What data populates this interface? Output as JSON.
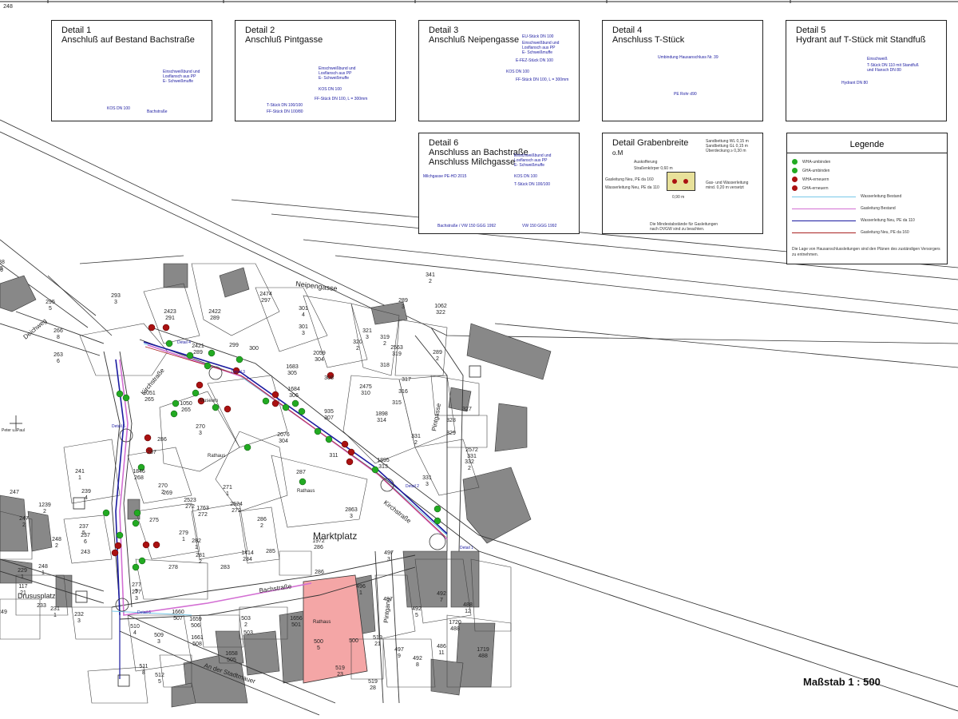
{
  "scale_label": "Maßstab 1 : 500",
  "details": [
    {
      "title1": "Detail 1",
      "title2": "Anschluß auf Bestand Bachstraße",
      "notes": [
        "Einschweißbund und",
        "Losflansch aus PP",
        "E- Schweißmuffe",
        "KOS DN 100",
        "Bachstraße"
      ]
    },
    {
      "title1": "Detail 2",
      "title2": "Anschluß Pintgasse",
      "notes": [
        "Einschweißbund und",
        "Losflansch aus PP",
        "E- Schweißmuffe",
        "KOS DN 100",
        "FF-Stück DN 100, L = 300mm",
        "T-Stück DN 100/100",
        "FF-Stück DN 100/80"
      ]
    },
    {
      "title1": "Detail 3",
      "title2": "Anschluß Neipengasse",
      "notes": [
        "EU-Stück DN 100",
        "Einschweißbund und",
        "Losflansch aus PP",
        "E- Schweißmuffe",
        "E-FEZ-Stück DN 100",
        "KOS DN 100",
        "FF-Stück DN 100, L = 300mm"
      ]
    },
    {
      "title1": "Detail 4",
      "title2": "Anschluss T-Stück",
      "notes": [
        "Umbindung Hausanschluss Nr. 39",
        "PE Rohr d90"
      ]
    },
    {
      "title1": "Detail 5",
      "title2": "Hydrant auf T-Stück mit Standfuß",
      "notes": [
        "Einschweiß",
        "T-Stück DN 110 mit Standfuß",
        "und Flansch DN 80",
        "Hydrant DN 80"
      ]
    },
    {
      "title1": "Detail 6",
      "title2": "Anschluss an Bachstraße",
      "title3": "Anschluss Milchgasse",
      "notes": [
        "Einschweißbund und",
        "Losflansch aus PP",
        "E- Schweißmuffe",
        "KOS DN 100",
        "T-Stück DN 100/100",
        "Milchgasse PE-HD 2015",
        "Bachstraße / VW 150 GGG 1992",
        "VW 150 GGG 1992"
      ]
    },
    {
      "title1": "Detail Grabenbreite",
      "title2": "o.M",
      "notes": [
        "Sandbettung WL 0,15 m",
        "Sandbettung GL 0,15 m",
        "Überdeckung ≥ 0,30 m",
        "Auskofferung",
        "Straßenkörper 0,60 m",
        "Gasleitung Neu, PE da 160",
        "Wasserleitung Neu, PE da 110",
        "Gas- und Wasserleitung",
        "mind. 0,20 m versetzt",
        "0,90 m",
        "Die Mindestabstände für Gasleitungen",
        "nach DVGW sind zu beachten."
      ]
    }
  ],
  "legend": {
    "title": "Legende",
    "items": [
      {
        "label": "WHA-umbinden",
        "color": "#22aa22"
      },
      {
        "label": "GHA-umbinden",
        "color": "#22aa22"
      },
      {
        "label": "WHA-erneuern",
        "color": "#aa1111"
      },
      {
        "label": "GHA-erneuern",
        "color": "#aa1111"
      }
    ],
    "lines": [
      {
        "label": "Wasserleitung Bestand",
        "color": "#77c8e8"
      },
      {
        "label": "Gasleitung Bestand",
        "color": "#d36fd3"
      },
      {
        "label": "Wasserleitung Neu, PE da 110",
        "color": "#1a1aa0"
      },
      {
        "label": "Gasleitung Neu, PE da 160",
        "color": "#aa2222"
      }
    ],
    "note": "Die Lage von Hausanschlussleitungen sind den Plänen des zuständigen Versorgers zu entnehmen."
  },
  "streets": [
    "Neipengasse",
    "Kirchstraße",
    "Kirchstraße",
    "Bachstraße",
    "Pintgasse",
    "Pintgang",
    "Marktplatz",
    "Drususplatz",
    "Deichweg",
    "An der Stadtmauer",
    "Rathaus",
    "Rathaus",
    "Rathaus",
    "Museum",
    "Peter u. Paul"
  ],
  "detail_markers": [
    "Detail 1",
    "Detail 2",
    "Detail 3",
    "Detail 4",
    "Detail 5",
    "Detail 6"
  ],
  "parcels": [
    "293\n3",
    "295\n5",
    "266\n8",
    "263\n6",
    "2423\n291",
    "2422\n289",
    "2474\n297",
    "301\n4",
    "301\n3",
    "300",
    "299",
    "2421\n289",
    "2059\n304",
    "1683\n305",
    "1684\n306",
    "308",
    "320\n2",
    "321\n3",
    "319\n2",
    "2563\n319",
    "318",
    "289\n3",
    "1062\n322",
    "289\n2",
    "341\n2",
    "317",
    "316",
    "315",
    "2475\n310",
    "935\n307",
    "1898\n314",
    "331\n2",
    "1895\n313",
    "311",
    "2572\n331",
    "332\n2",
    "331\n3",
    "327",
    "328",
    "329",
    "2076\n304",
    "1051\n265",
    "1050\n265",
    "270\n3",
    "286",
    "287",
    "1846\n268",
    "270\n2",
    "269",
    "241\n1",
    "239\n4",
    "2523\n272",
    "1763\n272",
    "2524\n272",
    "271\n1",
    "287",
    "2863\n3",
    "286\n2",
    "275",
    "279\n1",
    "282\n1",
    "281\n2",
    "283",
    "278",
    "277\n5",
    "277\n3",
    "1414\n284",
    "285",
    "1972\n286",
    "497\n3",
    "286",
    "496\n1",
    "497",
    "492\n5",
    "492\n7",
    "488\n12",
    "1720\n488",
    "1719\n488",
    "486\n11",
    "492\n8",
    "497\n9",
    "519\n21",
    "519\n28",
    "500\n5",
    "519\n23",
    "500",
    "503\n2",
    "503",
    "1656\n501",
    "1658\n505",
    "1659\n506",
    "1661\n508",
    "1660\n507",
    "509\n3",
    "510\n4",
    "511\n8",
    "512\n5",
    "232\n3",
    "231\n1",
    "233",
    "117\n21",
    "229\n1",
    "248\n1",
    "248\n2",
    "243",
    "237\n6",
    "237\n5",
    "1239\n2",
    "247\n2",
    "247",
    "249",
    "588\n15",
    "26",
    "248"
  ]
}
